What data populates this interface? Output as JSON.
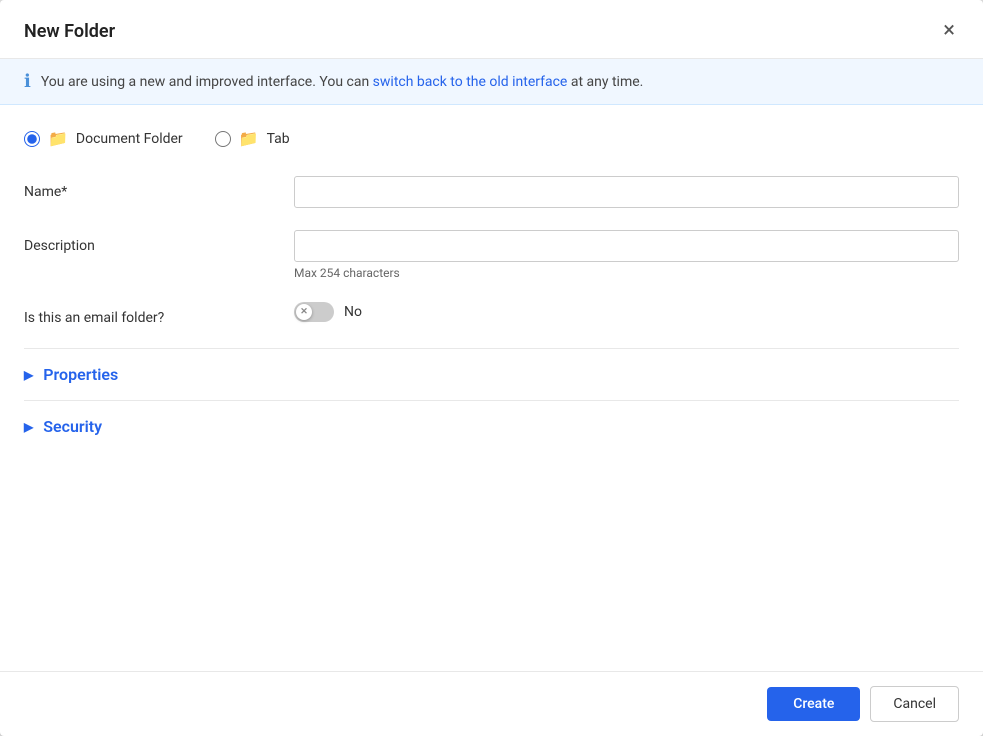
{
  "dialog": {
    "title": "New Folder",
    "close_label": "×"
  },
  "info_banner": {
    "text_before": "You are using a new and improved interface. You can",
    "link_text": "switch back to the old interface",
    "text_after": "at any time."
  },
  "folder_types": [
    {
      "id": "document",
      "label": "Document Folder",
      "selected": true
    },
    {
      "id": "tab",
      "label": "Tab",
      "selected": false
    }
  ],
  "form": {
    "name_label": "Name*",
    "name_placeholder": "",
    "description_label": "Description",
    "description_placeholder": "",
    "description_hint": "Max 254 characters",
    "email_folder_label": "Is this an email folder?",
    "toggle_value": "No"
  },
  "sections": [
    {
      "id": "properties",
      "label": "Properties"
    },
    {
      "id": "security",
      "label": "Security"
    }
  ],
  "footer": {
    "create_label": "Create",
    "cancel_label": "Cancel"
  }
}
